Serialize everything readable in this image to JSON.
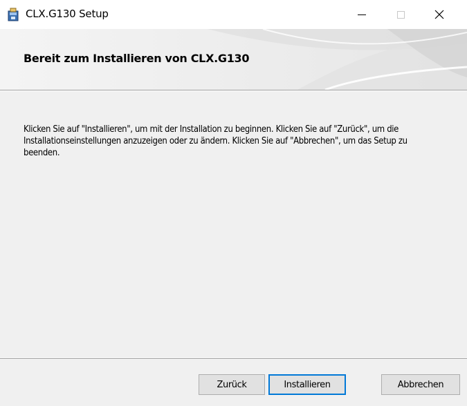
{
  "window": {
    "title": "CLX.G130 Setup",
    "minimize": "–",
    "maximize": "□",
    "close": "X"
  },
  "banner": {
    "title": "Bereit zum Installieren von CLX.G130"
  },
  "body": {
    "text": "Klicken Sie auf \"Installieren\", um mit der Installation zu beginnen. Klicken Sie auf \"Zurück\", um die Installationseinstellungen anzuzeigen oder zu ändern. Klicken Sie auf \"Abbrechen\", um das Setup zu beenden."
  },
  "buttons": {
    "back": "Zurück",
    "install": "Installieren",
    "cancel": "Abbrechen"
  },
  "colors": {
    "accent": "#0078d7",
    "background": "#f0f0f0"
  }
}
